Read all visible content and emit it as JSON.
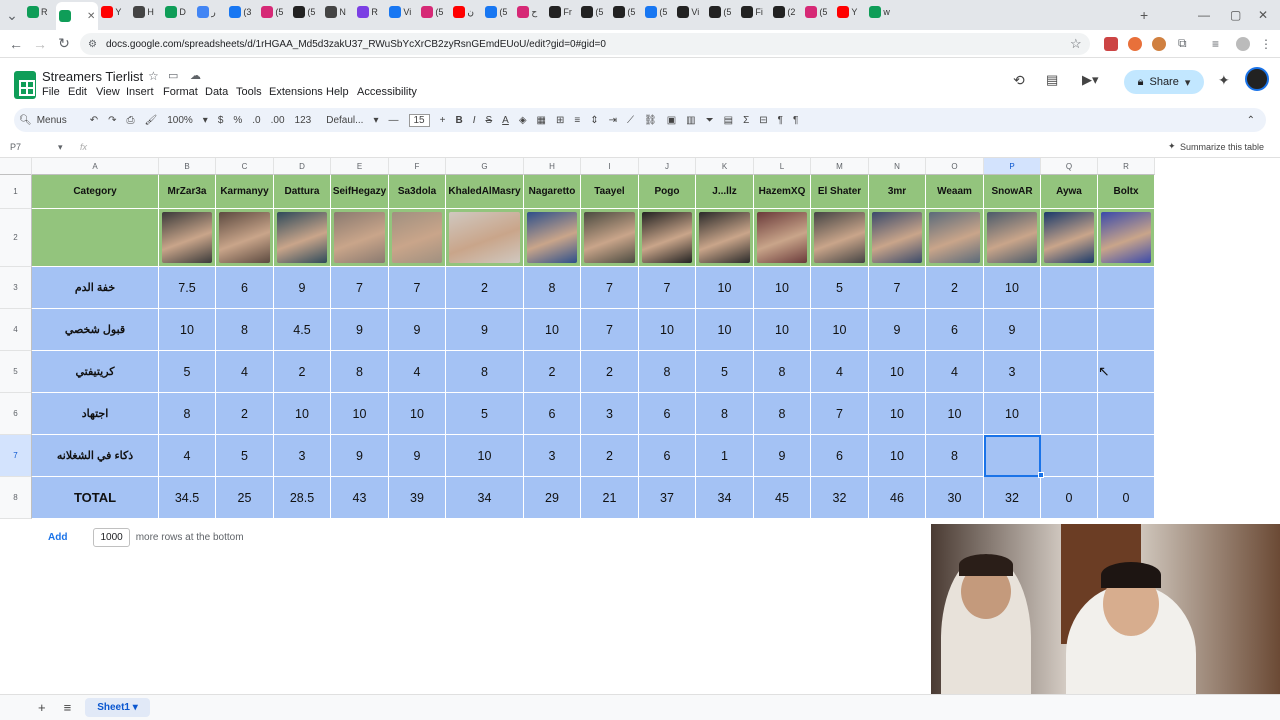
{
  "browser": {
    "tabs": [
      "R",
      "",
      "Y",
      "H",
      "D",
      "ر",
      "(3",
      "(5",
      "(5",
      "N",
      "R",
      "Vi",
      "(5",
      "ن",
      "(5",
      "ح",
      "Fr",
      "(5",
      "(5",
      "(5",
      "Vi",
      "(5",
      "Fi",
      "(2",
      "(5",
      "Y",
      "w"
    ],
    "url": "docs.google.com/spreadsheets/d/1rHGAA_Md5d3zakU37_RWuSbYcXrCB2zyRsnGEmdEUoU/edit?gid=0#gid=0"
  },
  "doc": {
    "title": "Streamers Tierlist",
    "menus": [
      "File",
      "Edit",
      "View",
      "Insert",
      "Format",
      "Data",
      "Tools",
      "Extensions",
      "Help",
      "Accessibility"
    ],
    "share_label": "Share"
  },
  "toolbar": {
    "menus_label": "Menus",
    "zoom": "100%",
    "currency": "$",
    "percent": "%",
    "dec_less": ".0",
    "dec_more": ".00",
    "num_fmt": "123",
    "font": "Defaul...",
    "font_size": "15",
    "bold": "B",
    "italic": "I"
  },
  "formula_bar": {
    "cell_ref": "P7",
    "fx": "fx",
    "summarize": "Summarize this table"
  },
  "grid": {
    "col_letters": [
      "A",
      "B",
      "C",
      "D",
      "E",
      "F",
      "G",
      "H",
      "I",
      "J",
      "K",
      "L",
      "M",
      "N",
      "O",
      "P",
      "Q",
      "R"
    ],
    "row_numbers": [
      "1",
      "2",
      "3",
      "4",
      "5",
      "6",
      "7",
      "8"
    ],
    "category_header": "Category",
    "streamers": [
      "MrZar3a",
      "Karmanyy",
      "Dattura",
      "SeifHegazy",
      "Sa3dola",
      "KhaledAlMasry",
      "Nagaretto",
      "Taayel",
      "Pogo",
      "J...llz",
      "HazemXQ",
      "El Shater",
      "3mr",
      "Weaam",
      "SnowAR",
      "Aywa",
      "Boltx"
    ],
    "categories": [
      "خفة الدم",
      "قبول شخصي",
      "كريتيفتي",
      "اجتهاد",
      "ذكاء في الشغلانه"
    ],
    "scores": [
      [
        "7.5",
        "6",
        "9",
        "7",
        "7",
        "2",
        "8",
        "7",
        "7",
        "10",
        "10",
        "5",
        "7",
        "2",
        "10",
        "",
        ""
      ],
      [
        "10",
        "8",
        "4.5",
        "9",
        "9",
        "9",
        "10",
        "7",
        "10",
        "10",
        "10",
        "10",
        "9",
        "6",
        "9",
        "",
        ""
      ],
      [
        "5",
        "4",
        "2",
        "8",
        "4",
        "8",
        "2",
        "2",
        "8",
        "5",
        "8",
        "4",
        "10",
        "4",
        "3",
        "",
        ""
      ],
      [
        "8",
        "2",
        "10",
        "10",
        "10",
        "5",
        "6",
        "3",
        "6",
        "8",
        "8",
        "7",
        "10",
        "10",
        "10",
        "",
        ""
      ],
      [
        "4",
        "5",
        "3",
        "9",
        "9",
        "10",
        "3",
        "2",
        "6",
        "1",
        "9",
        "6",
        "10",
        "8",
        "",
        "",
        ""
      ]
    ],
    "total_label": "TOTAL",
    "totals": [
      "34.5",
      "25",
      "28.5",
      "43",
      "39",
      "34",
      "29",
      "21",
      "37",
      "34",
      "45",
      "32",
      "46",
      "30",
      "32",
      "0",
      "0"
    ]
  },
  "add_rows": {
    "label": "Add",
    "count": "1000",
    "suffix": "more rows at the bottom"
  },
  "sheet_tab": "Sheet1",
  "colors": {
    "header_green": "#93c47d",
    "body_blue": "#a4c2f4",
    "selection": "#1a73e8"
  }
}
